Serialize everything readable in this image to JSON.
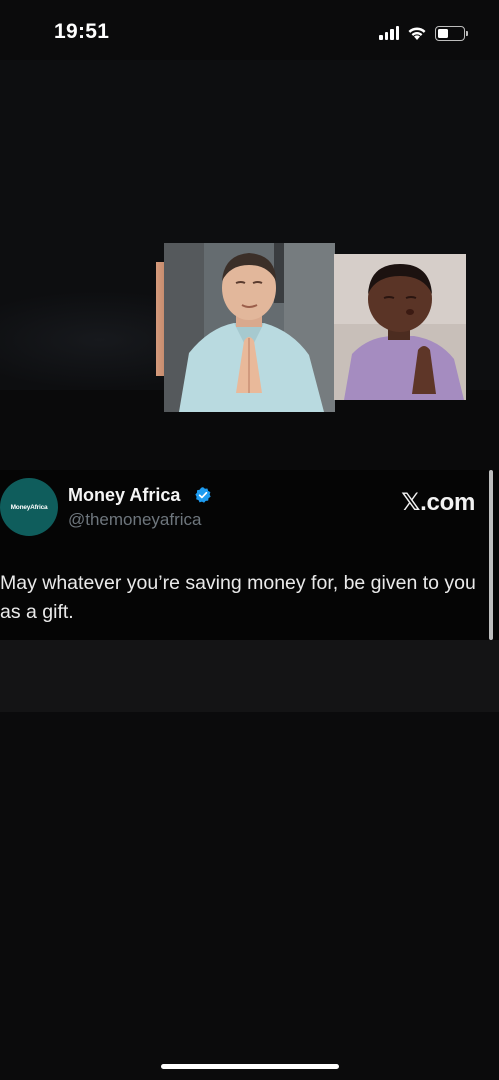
{
  "status_bar": {
    "time": "19:51",
    "battery_level": 0.45
  },
  "tweet": {
    "avatar_text": "MoneyAfrica",
    "display_name": "Money Africa",
    "handle": "@themoneyafrica",
    "source": "𝕏.com",
    "text": "May whatever you’re saving money for, be given to you as a gift."
  },
  "colors": {
    "background": "#0b0b0c",
    "avatar": "#0f5d5c",
    "verified": "#1d9bf0",
    "handle": "#6e767d"
  },
  "icons": [
    "signal-icon",
    "wifi-icon",
    "battery-icon",
    "verified-badge-icon"
  ]
}
